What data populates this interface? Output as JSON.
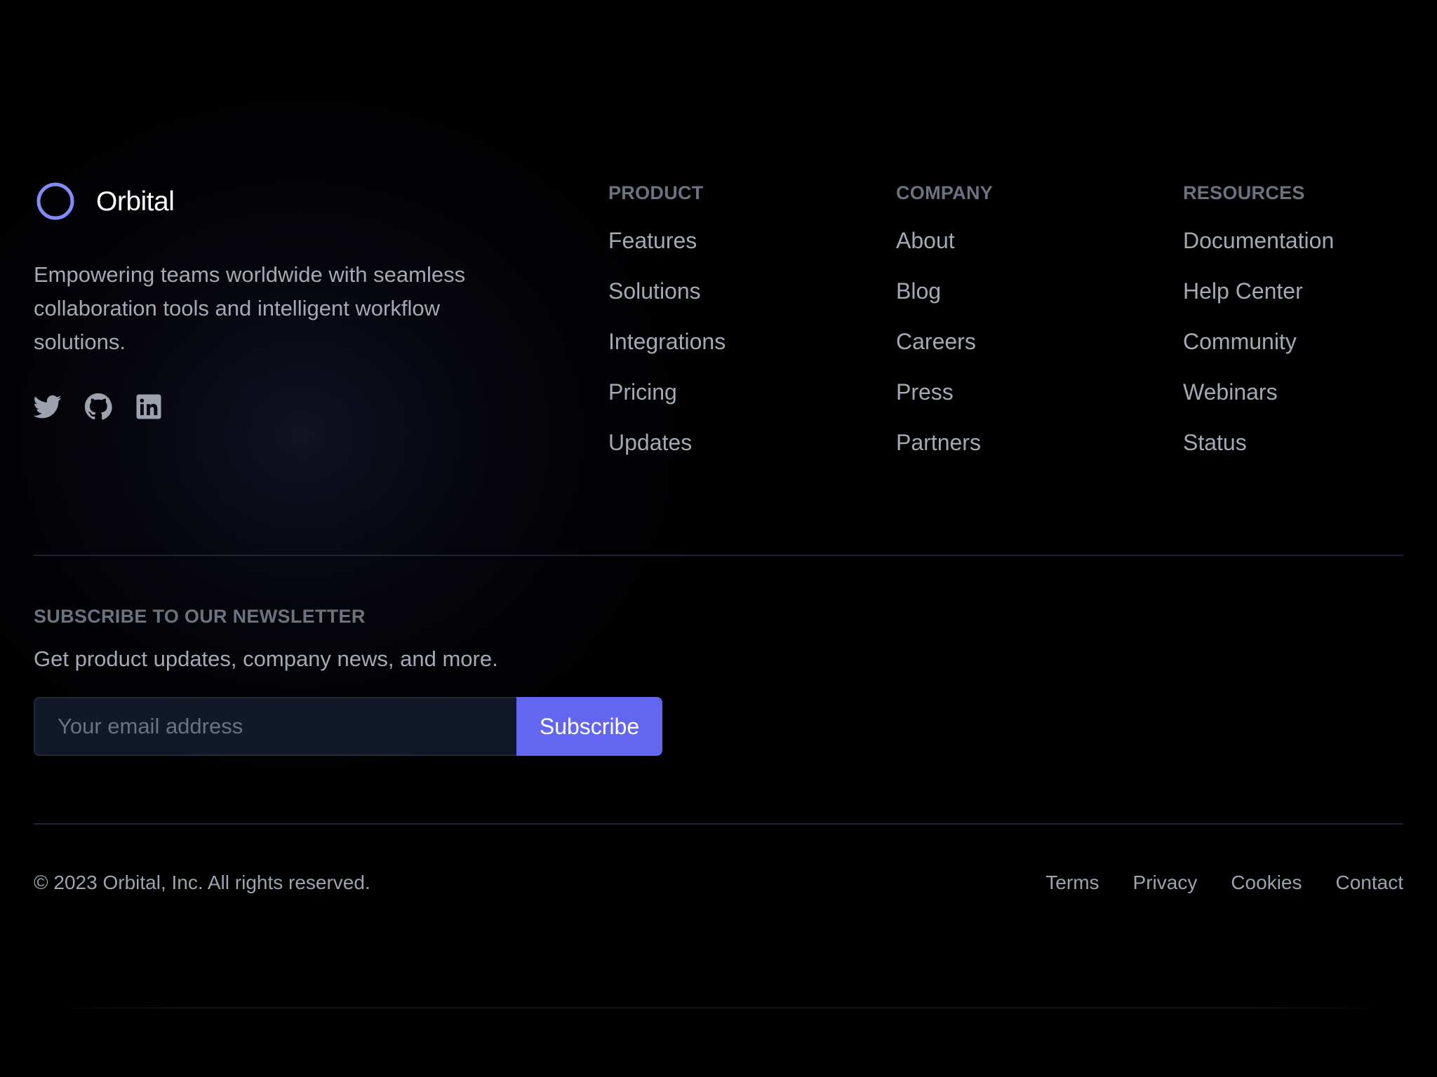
{
  "brand": {
    "name": "Orbital",
    "tagline": "Empowering teams worldwide with seamless collaboration tools and intelligent workflow solutions.",
    "logo_icon": "ring-logo-icon",
    "accent_color": "#818cf8"
  },
  "social": [
    {
      "icon": "twitter-icon"
    },
    {
      "icon": "github-icon"
    },
    {
      "icon": "linkedin-icon"
    }
  ],
  "columns": [
    {
      "title": "PRODUCT",
      "links": [
        "Features",
        "Solutions",
        "Integrations",
        "Pricing",
        "Updates"
      ]
    },
    {
      "title": "COMPANY",
      "links": [
        "About",
        "Blog",
        "Careers",
        "Press",
        "Partners"
      ]
    },
    {
      "title": "RESOURCES",
      "links": [
        "Documentation",
        "Help Center",
        "Community",
        "Webinars",
        "Status"
      ]
    }
  ],
  "newsletter": {
    "title": "SUBSCRIBE TO OUR NEWSLETTER",
    "description": "Get product updates, company news, and more.",
    "email_placeholder": "Your email address",
    "email_value": "",
    "button_label": "Subscribe",
    "button_color": "#6366f1"
  },
  "bottom": {
    "copyright": "© 2023 Orbital, Inc. All rights reserved.",
    "links": [
      "Terms",
      "Privacy",
      "Cookies",
      "Contact"
    ]
  }
}
